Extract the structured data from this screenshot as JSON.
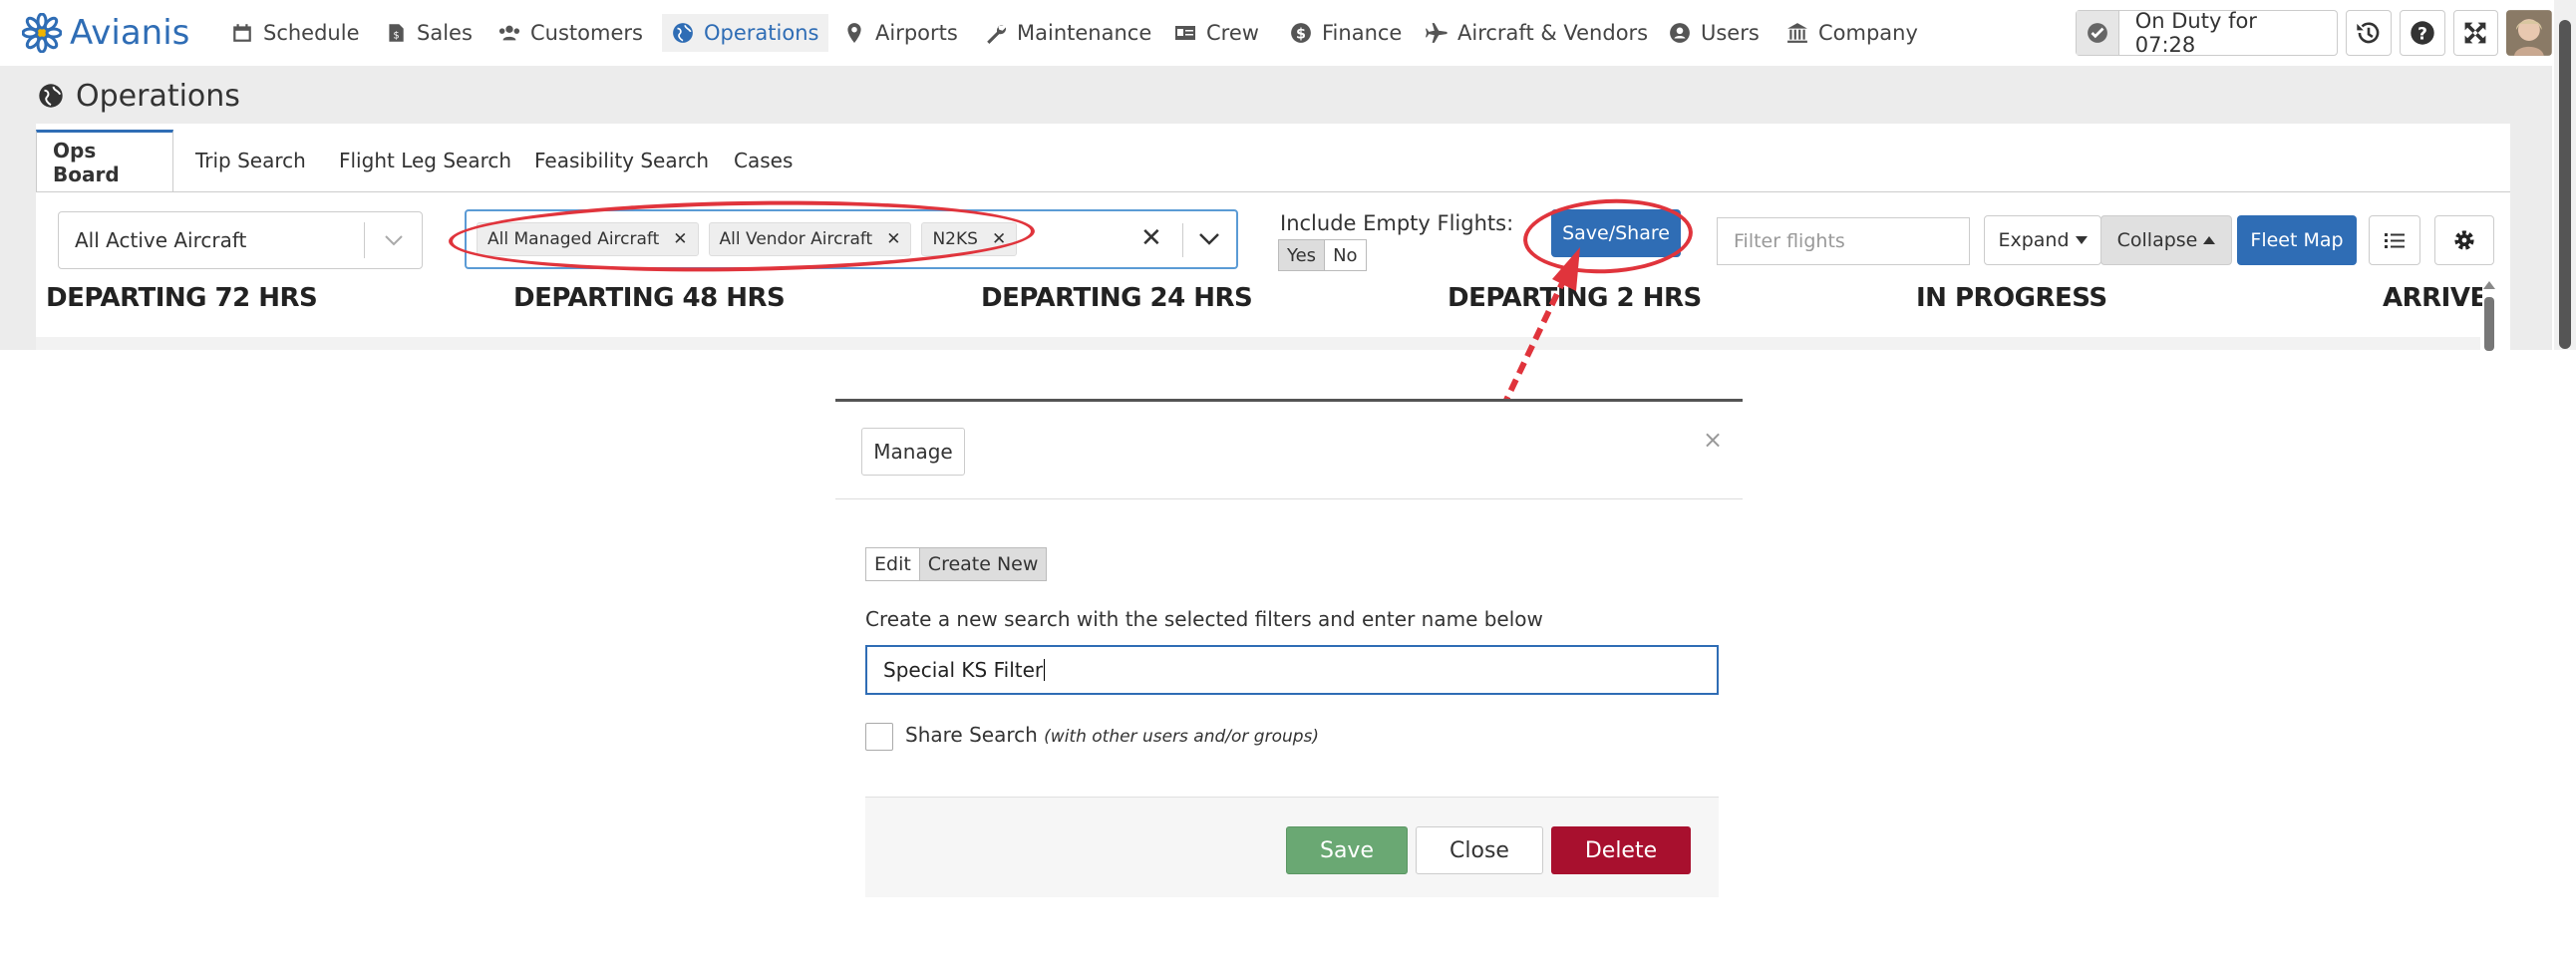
{
  "nav": {
    "brand": "Avianis",
    "items": [
      {
        "label": "Schedule",
        "icon": "calendar-icon"
      },
      {
        "label": "Sales",
        "icon": "file-dollar-icon"
      },
      {
        "label": "Customers",
        "icon": "users-icon"
      },
      {
        "label": "Operations",
        "icon": "globe-icon",
        "active": true
      },
      {
        "label": "Airports",
        "icon": "map-marker-icon"
      },
      {
        "label": "Maintenance",
        "icon": "wrench-icon"
      },
      {
        "label": "Crew",
        "icon": "id-card-icon"
      },
      {
        "label": "Finance",
        "icon": "dollar-circle-icon"
      },
      {
        "label": "Aircraft & Vendors",
        "icon": "plane-icon"
      },
      {
        "label": "Users",
        "icon": "user-circle-icon"
      },
      {
        "label": "Company",
        "icon": "bank-icon"
      }
    ],
    "duty_status": "On Duty for 07:28"
  },
  "page": {
    "title": "Operations"
  },
  "tabs": [
    "Ops Board",
    "Trip Search",
    "Flight Leg Search",
    "Feasibility Search",
    "Cases"
  ],
  "filters": {
    "aircraft_select": "All Active Aircraft",
    "chips": [
      "All Managed Aircraft",
      "All Vendor Aircraft",
      "N2KS"
    ],
    "include_empty_label": "Include Empty Flights:",
    "yes": "Yes",
    "no": "No",
    "save_share": "Save/Share",
    "filter_placeholder": "Filter flights",
    "expand": "Expand",
    "collapse": "Collapse",
    "fleet_map": "Fleet Map"
  },
  "columns": [
    "DEPARTING 72 HRS",
    "DEPARTING 48 HRS",
    "DEPARTING 24 HRS",
    "DEPARTING 2 HRS",
    "IN PROGRESS",
    "ARRIVED"
  ],
  "modal": {
    "manage": "Manage",
    "close_x": "×",
    "edit": "Edit",
    "create_new": "Create New",
    "description": "Create a new search with the selected filters and enter name below",
    "name_value": "Special KS Filter",
    "share_label": "Share Search",
    "share_hint": "(with other users and/or groups)",
    "save": "Save",
    "close": "Close",
    "delete": "Delete"
  },
  "colors": {
    "accent": "#2f6db5",
    "save": "#6aa873",
    "delete": "#a8102e",
    "annotation": "#e0343c"
  }
}
